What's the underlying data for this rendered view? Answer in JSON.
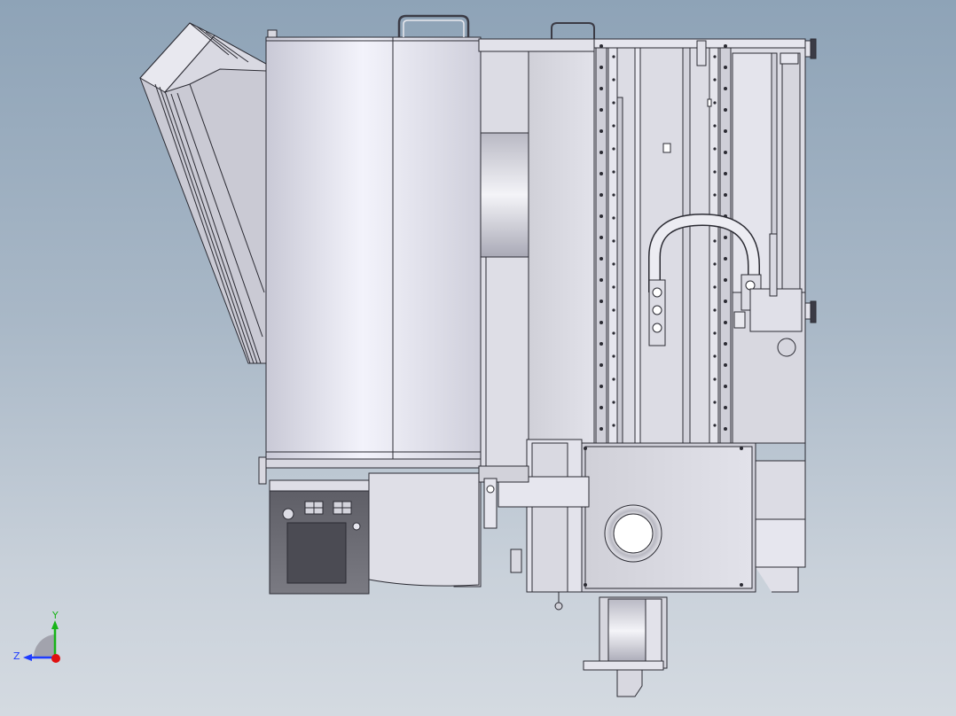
{
  "view": {
    "background_top": "#8ea3b7",
    "background_bottom": "#d4dae1",
    "line_color": "#2b2b33",
    "body_fill": "#e4e4ec",
    "panel_fill": "#d6d6de",
    "control_box_fill": "#6a6a72"
  },
  "triad": {
    "y_label": "Y",
    "z_label": "Z",
    "y_color": "#18b418",
    "z_color": "#1e3cff",
    "x_color": "#e01010"
  }
}
